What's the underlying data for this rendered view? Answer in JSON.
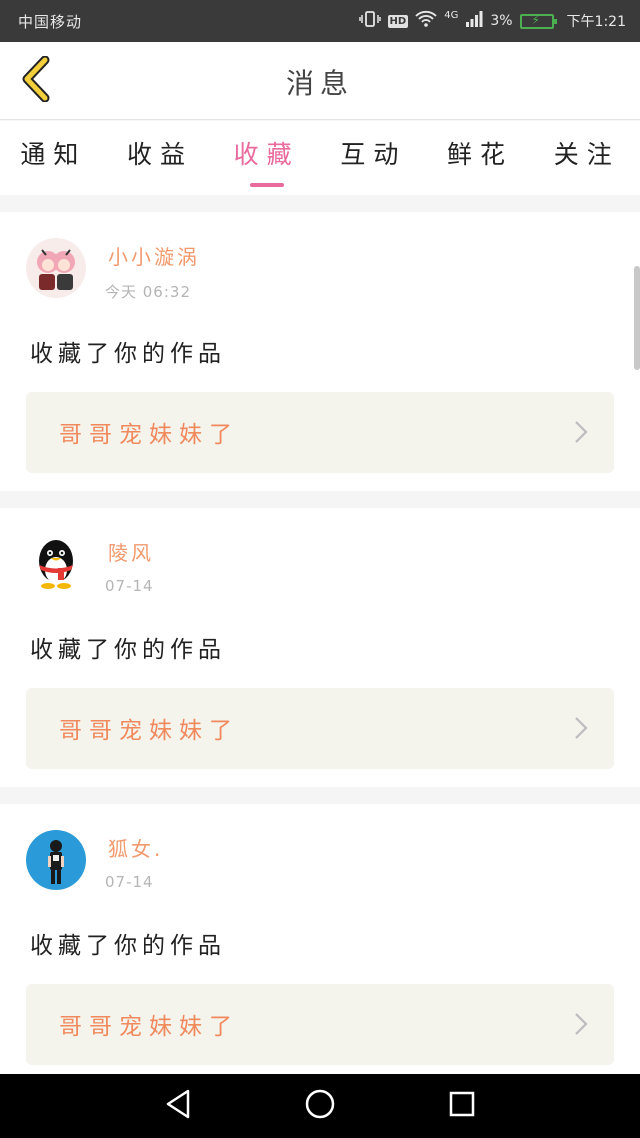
{
  "status_bar": {
    "carrier": "中国移动",
    "network": "4G",
    "battery": "3%",
    "time": "下午1:21",
    "hd_label": "HD"
  },
  "header": {
    "title": "消息"
  },
  "tabs": [
    {
      "label": "通知"
    },
    {
      "label": "收益"
    },
    {
      "label": "收藏",
      "active": true
    },
    {
      "label": "互动"
    },
    {
      "label": "鲜花"
    },
    {
      "label": "关注"
    }
  ],
  "messages": [
    {
      "user": "小小漩涡",
      "time": "今天 06:32",
      "action": "收藏了你的作品",
      "work": "哥哥宠妹妹了"
    },
    {
      "user": "陵风",
      "time": "07-14",
      "action": "收藏了你的作品",
      "work": "哥哥宠妹妹了"
    },
    {
      "user": "狐女.",
      "time": "07-14",
      "action": "收藏了你的作品",
      "work": "哥哥宠妹妹了"
    }
  ],
  "colors": {
    "accent_pink": "#e96a9d",
    "username_orange": "#f29a6e",
    "work_orange": "#f08a5d",
    "back_icon_yellow": "#f2cf3b"
  },
  "icons": {
    "back": "back-chevron-icon",
    "item_chevron": "chevron-right-icon",
    "nav_back": "triangle-back-icon",
    "nav_home": "circle-home-icon",
    "nav_recent": "square-recent-icon"
  }
}
